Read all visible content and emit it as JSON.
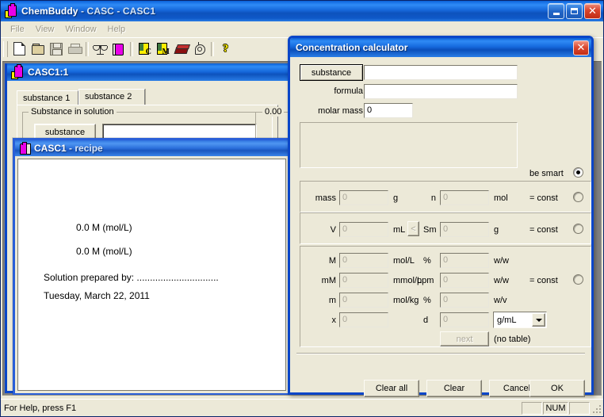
{
  "app": {
    "title_main": "ChemBuddy",
    "title_sep1": " - ",
    "title_doc": "CASC - CASC1",
    "title_full": "ChemBuddy - CASC - CASC1"
  },
  "window_controls": {
    "minimize": "Minimize",
    "maximize": "Maximize",
    "close": "Close",
    "close_glyph": "✕"
  },
  "menubar": {
    "items": [
      {
        "label": "File"
      },
      {
        "label": "View"
      },
      {
        "label": "Window"
      },
      {
        "label": "Help"
      }
    ]
  },
  "toolbar": {
    "buttons": [
      {
        "icon": "new-document-icon",
        "tip": "New"
      },
      {
        "icon": "open-folder-icon",
        "tip": "Open"
      },
      {
        "icon": "save-disk-icon",
        "tip": "Save"
      },
      {
        "icon": "printer-icon",
        "tip": "Print"
      },
      {
        "icon": "balance-scale-icon",
        "tip": "Balance"
      },
      {
        "icon": "flask-icon",
        "tip": "Solution"
      },
      {
        "icon": "concentration-c-icon",
        "tip": "Concentration calculator"
      },
      {
        "icon": "molar-m-icon",
        "tip": "Molar mass"
      },
      {
        "icon": "book-icon",
        "tip": "Tables"
      },
      {
        "icon": "atom-icon",
        "tip": "Periodic table"
      },
      {
        "icon": "help-question-icon",
        "tip": "Help"
      }
    ],
    "help_glyph": "?"
  },
  "mdi_child": {
    "title": "CASC1:1",
    "tabs": [
      {
        "label": "substance 1",
        "selected": false
      },
      {
        "label": "substance 2",
        "selected": true
      }
    ],
    "group_label": "Substance in solution",
    "substance_button": "substance",
    "substance_value": "",
    "concentration_label": "0.00"
  },
  "recipe_window": {
    "title_doc": "CASC1",
    "title_sep": " - ",
    "title_kind": "recipe",
    "title_full": "CASC1 - recipe",
    "lines": [
      "0.0 M (mol/L)",
      "0.0 M (mol/L)",
      "Solution prepared by: ...............................",
      "Tuesday, March 22, 2011"
    ]
  },
  "dialog": {
    "title": "Concentration calculator",
    "close_glyph": "✕",
    "substance_button": "substance",
    "substance_value": "",
    "formula_label": "formula",
    "formula_value": "",
    "molar_mass_label": "molar mass",
    "molar_mass_value": "0",
    "notes_value": "",
    "be_smart_label": "be smart",
    "be_smart_selected": true,
    "rows": {
      "mass_label": "mass",
      "mass_value": "0",
      "mass_unit": "g",
      "n_label": "n",
      "n_value": "0",
      "n_unit": "mol",
      "v_label": "V",
      "v_value": "0",
      "v_unit": "mL",
      "lt_button": "<",
      "sm_label": "Sm",
      "sm_value": "0",
      "sm_unit": "g",
      "molar_label": "M",
      "molar_value": "0",
      "molar_unit": "mol/L",
      "pct_ww_label": "%",
      "pct_ww_value": "0",
      "pct_ww_unit": "w/w",
      "mm_label": "mM",
      "mm_value": "0",
      "mm_unit": "mmol/L",
      "ppm_label": "ppm",
      "ppm_value": "0",
      "ppm_unit": "w/w",
      "m_label": "m",
      "m_value": "0",
      "m_unit": "mol/kg",
      "pct_wv_label": "%",
      "pct_wv_value": "0",
      "pct_wv_unit": "w/v",
      "x_label": "x",
      "x_value": "0",
      "d_label": "d",
      "d_value": "0",
      "density_unit": "g/mL",
      "next_button": "next",
      "no_table": "(no table)"
    },
    "const_label_1": "= const",
    "const_label_2": "= const",
    "const_label_3": "= const",
    "const_selected_1": false,
    "const_selected_2": false,
    "const_selected_3": false,
    "buttons": {
      "clear_all": "Clear all",
      "clear": "Clear",
      "cancel": "Cancel",
      "ok": "OK"
    }
  },
  "statusbar": {
    "hint": "For Help, press F1",
    "pane_caps": "",
    "pane_num": "NUM",
    "pane_scrl": ""
  },
  "colors": {
    "title_blue": "#0a5fd4",
    "dialog_border": "#0a46c8",
    "face": "#ece9d8",
    "mdi_background": "#808080",
    "close_red": "#c22d14",
    "magenta": "#e800e8",
    "yellow": "#ffee00"
  }
}
